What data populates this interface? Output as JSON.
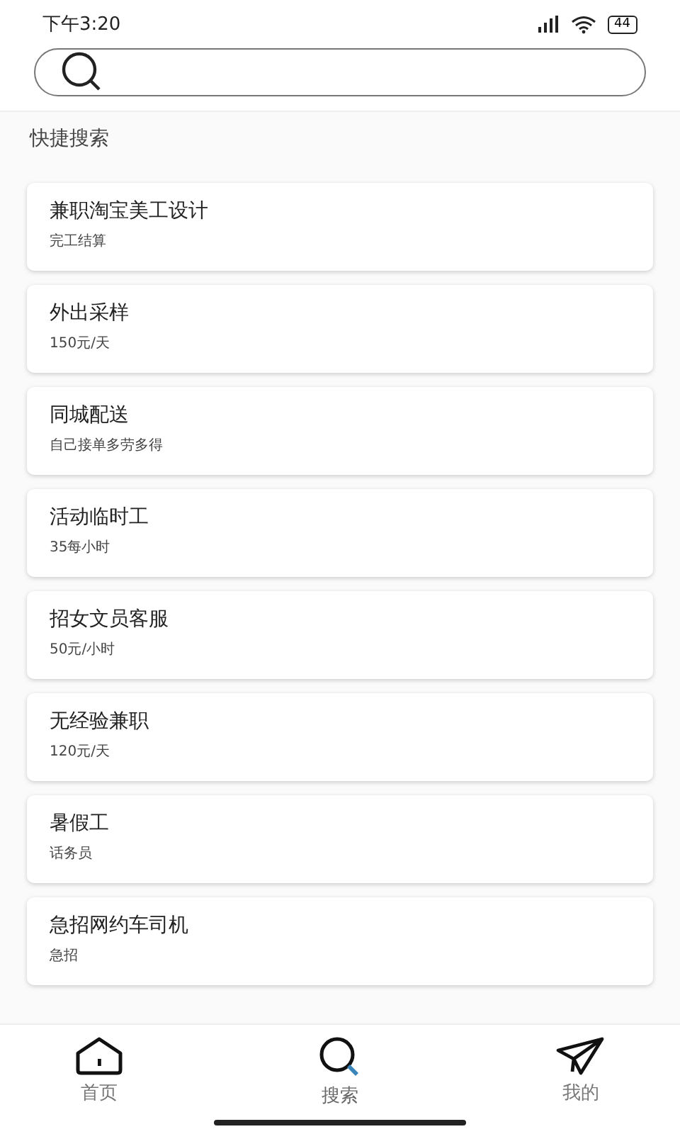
{
  "status_bar": {
    "time": "下午3:20",
    "battery": "44"
  },
  "section_title": "快捷搜索",
  "items": [
    {
      "title": "兼职淘宝美工设计",
      "subtitle": "完工结算"
    },
    {
      "title": "外出采样",
      "subtitle": "150元/天"
    },
    {
      "title": "同城配送",
      "subtitle": "自己接单多劳多得"
    },
    {
      "title": "活动临时工",
      "subtitle": "35每小时"
    },
    {
      "title": "招女文员客服",
      "subtitle": "50元/小时"
    },
    {
      "title": "无经验兼职",
      "subtitle": "120元/天"
    },
    {
      "title": "暑假工",
      "subtitle": "话务员"
    },
    {
      "title": "急招网约车司机",
      "subtitle": "急招"
    }
  ],
  "tabs": [
    {
      "kind": "home",
      "label": "首页",
      "selected": false
    },
    {
      "kind": "search",
      "label": "搜索",
      "selected": true
    },
    {
      "kind": "send",
      "label": "我的",
      "selected": false
    }
  ]
}
